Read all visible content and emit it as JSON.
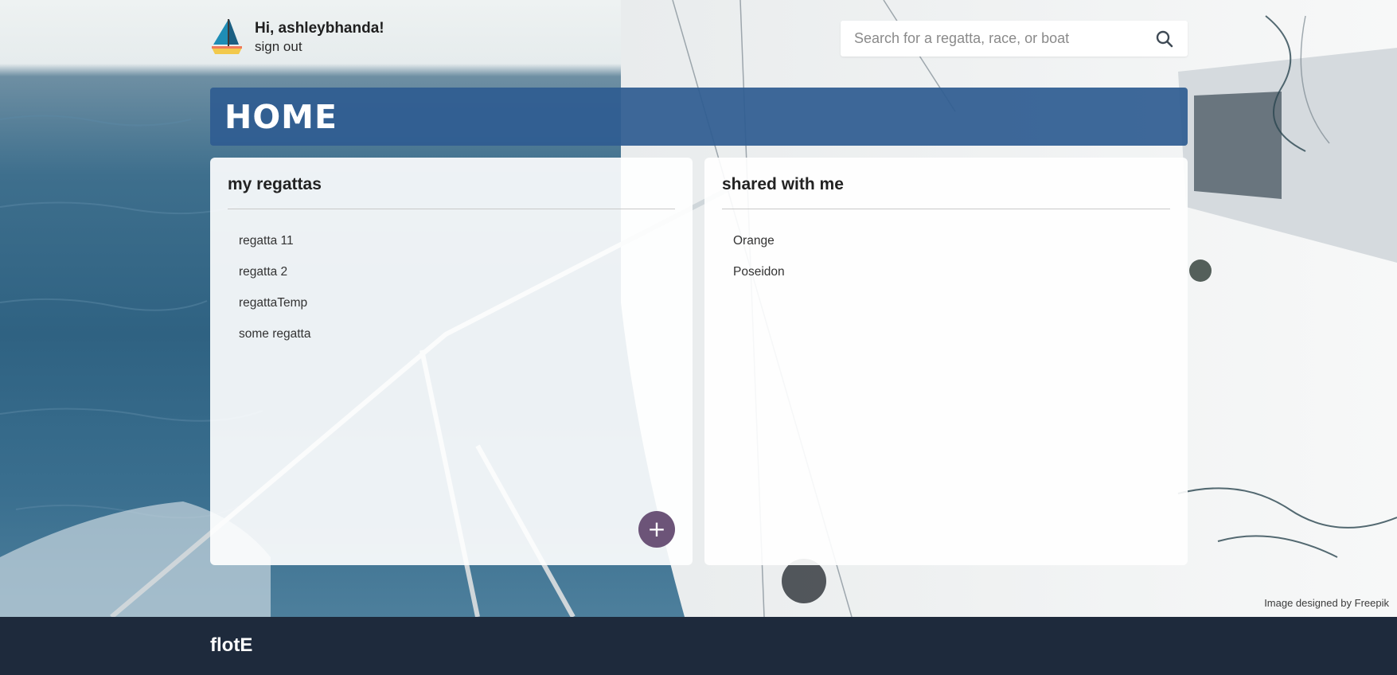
{
  "header": {
    "greeting": "Hi, ashleybhanda!",
    "sign_out_label": "sign out",
    "logo_icon": "sailboat-icon"
  },
  "search": {
    "placeholder": "Search for a regatta, race, or boat",
    "value": "",
    "icon": "search-icon"
  },
  "page": {
    "title": "HOME"
  },
  "my_regattas": {
    "heading": "my regattas",
    "items": [
      {
        "label": "regatta 11"
      },
      {
        "label": "regatta 2"
      },
      {
        "label": "regattaTemp"
      },
      {
        "label": "some regatta"
      }
    ],
    "add_button_label": "+"
  },
  "shared_with_me": {
    "heading": "shared with me",
    "items": [
      {
        "label": "Orange"
      },
      {
        "label": "Poseidon"
      }
    ]
  },
  "image_credit": "Image designed by Freepik",
  "footer": {
    "brand": "flotE"
  },
  "colors": {
    "title_bar": "#2f5c91",
    "add_button": "#6c5478",
    "footer": "#1e2a3c"
  }
}
